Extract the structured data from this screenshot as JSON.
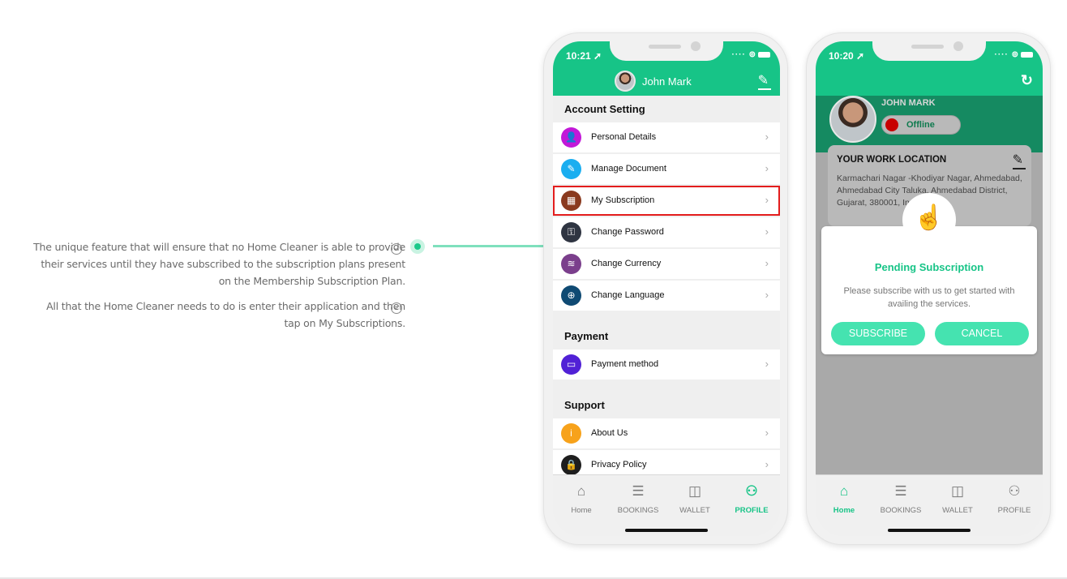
{
  "features": [
    {
      "text": "The unique feature that will ensure that no Home Cleaner is able to provide their services until they have subscribed to the subscription plans present on the Membership Subscription Plan."
    },
    {
      "text": "All that the Home Cleaner needs to do is enter their application and then tap on My Subscriptions."
    }
  ],
  "colors": {
    "accent": "#17c487",
    "highlight": "#e31d1d",
    "button": "#45e3b0",
    "offline": "#c80000"
  },
  "phone1": {
    "status": {
      "time": "10:21 ➚",
      "icons": "···· ⊚"
    },
    "header": {
      "user_name": "John Mark",
      "edit_icon": "pencil-icon"
    },
    "sections": [
      {
        "title": "Account Setting",
        "items": [
          {
            "label": "Personal Details",
            "icon": "person-icon",
            "glyph": "👤",
            "color": "#c218d8"
          },
          {
            "label": "Manage Document",
            "icon": "document-icon",
            "glyph": "✎",
            "color": "#1aaef0"
          },
          {
            "label": "My Subscription",
            "icon": "subscription-icon",
            "glyph": "▦",
            "color": "#8a3a1f",
            "highlighted": true
          },
          {
            "label": "Change Password",
            "icon": "key-icon",
            "glyph": "⚿",
            "color": "#2f3542"
          },
          {
            "label": "Change Currency",
            "icon": "coins-icon",
            "glyph": "≋",
            "color": "#7b3f8c"
          },
          {
            "label": "Change Language",
            "icon": "globe-icon",
            "glyph": "⊕",
            "color": "#0f4a73"
          }
        ]
      },
      {
        "title": "Payment",
        "items": [
          {
            "label": "Payment method",
            "icon": "card-icon",
            "glyph": "▭",
            "color": "#5121d6"
          }
        ]
      },
      {
        "title": "Support",
        "items": [
          {
            "label": "About Us",
            "icon": "info-icon",
            "glyph": "i",
            "color": "#f7a21b"
          },
          {
            "label": "Privacy Policy",
            "icon": "lock-icon",
            "glyph": "🔒",
            "color": "#1e1e1e"
          }
        ]
      }
    ],
    "tabs": [
      {
        "label": "Home",
        "glyph": "⌂",
        "active": false
      },
      {
        "label": "BOOKINGS",
        "glyph": "☰",
        "active": false
      },
      {
        "label": "WALLET",
        "glyph": "◫",
        "active": false
      },
      {
        "label": "PROFILE",
        "glyph": "⚇",
        "active": true
      }
    ]
  },
  "phone2": {
    "status": {
      "time": "10:20 ➚",
      "icons": "···· ⊚"
    },
    "user_name": "JOHN MARK",
    "status_toggle": "Offline",
    "location": {
      "title": "YOUR WORK LOCATION",
      "address": "Karmachari Nagar -Khodiyar Nagar, Ahmedabad, Ahmedabad City Taluka, Ahmedabad District, Gujarat, 380001, India"
    },
    "modal": {
      "title": "Pending Subscription",
      "text": "Please subscribe with us to get started with availing the services.",
      "subscribe": "SUBSCRIBE",
      "cancel": "CANCEL"
    },
    "tabs": [
      {
        "label": "Home",
        "glyph": "⌂",
        "active": true
      },
      {
        "label": "BOOKINGS",
        "glyph": "☰",
        "active": false
      },
      {
        "label": "WALLET",
        "glyph": "◫",
        "active": false
      },
      {
        "label": "PROFILE",
        "glyph": "⚇",
        "active": false
      }
    ]
  }
}
